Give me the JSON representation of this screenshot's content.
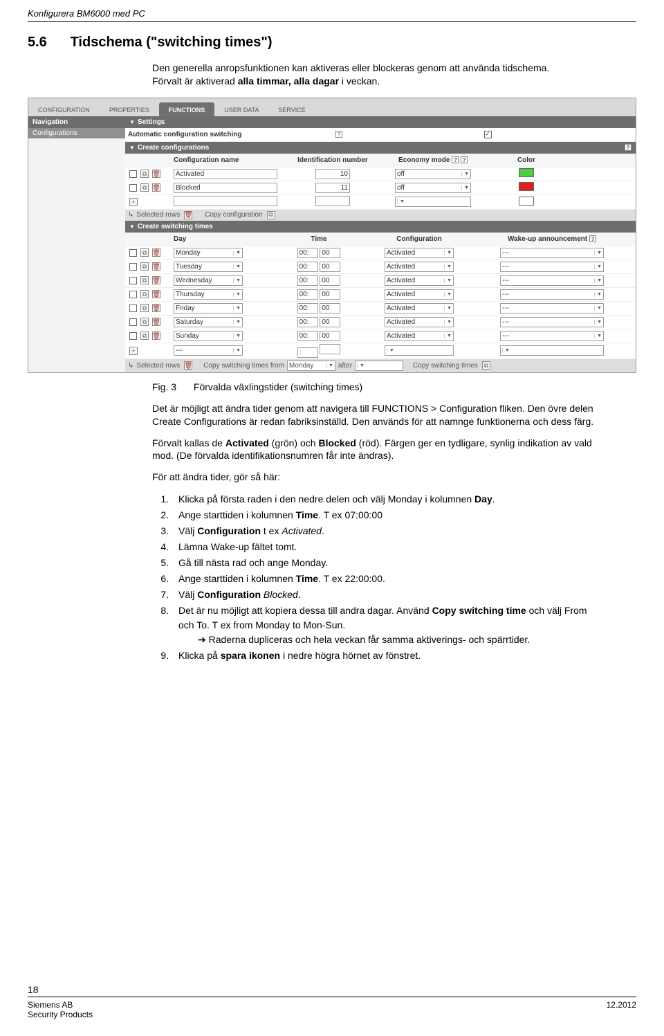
{
  "header": {
    "title": "Konfigurera BM6000 med PC"
  },
  "section": {
    "number": "5.6",
    "title": "Tidschema (\"switching times\")"
  },
  "intro": "Den generella anropsfunktionen kan aktiveras eller blockeras genom att använda tidschema. Förvalt är aktiverad alla timmar, alla dagar i veckan.",
  "ui": {
    "tabs": [
      "CONFIGURATION",
      "PROPERTIES",
      "FUNCTIONS",
      "USER DATA",
      "SERVICE"
    ],
    "active_tab": "FUNCTIONS",
    "sidebar": {
      "title": "Navigation",
      "items": [
        "Configurations"
      ]
    },
    "panels": {
      "settings": {
        "title": "Settings",
        "label": "Automatic configuration switching",
        "checked": true
      },
      "create_configs": {
        "title": "Create configurations",
        "headers": [
          "Configuration name",
          "Identification number",
          "Economy mode",
          "Color"
        ],
        "rows": [
          {
            "name": "Activated",
            "id": "10",
            "econ": "off",
            "color": "#4bcf3a"
          },
          {
            "name": "Blocked",
            "id": "11",
            "econ": "off",
            "color": "#e02020"
          },
          {
            "name": "",
            "id": "",
            "econ": "",
            "color": ""
          }
        ],
        "footer": {
          "selected": "Selected rows",
          "copy": "Copy configuration"
        }
      },
      "switching": {
        "title": "Create switching times",
        "headers": [
          "Day",
          "Time",
          "Configuration",
          "Wake-up announcement"
        ],
        "rows": [
          {
            "day": "Monday",
            "h": "00:",
            "m": "00",
            "conf": "Activated",
            "wake": "---"
          },
          {
            "day": "Tuesday",
            "h": "00:",
            "m": "00",
            "conf": "Activated",
            "wake": "---"
          },
          {
            "day": "Wednesday",
            "h": "00:",
            "m": "00",
            "conf": "Activated",
            "wake": "---"
          },
          {
            "day": "Thursday",
            "h": "00:",
            "m": "00",
            "conf": "Activated",
            "wake": "---"
          },
          {
            "day": "Friday",
            "h": "00:",
            "m": "00",
            "conf": "Activated",
            "wake": "---"
          },
          {
            "day": "Saturday",
            "h": "00:",
            "m": "00",
            "conf": "Activated",
            "wake": "---"
          },
          {
            "day": "Sunday",
            "h": "00:",
            "m": "00",
            "conf": "Activated",
            "wake": "---"
          },
          {
            "day": "---",
            "h": ":",
            "m": "",
            "conf": "",
            "wake": ""
          }
        ],
        "footer": {
          "selected": "Selected rows",
          "copy_label": "Copy switching times from",
          "from": "Monday",
          "after_label": "after",
          "after": "",
          "btn": "Copy switching times"
        }
      }
    }
  },
  "figure": {
    "number": "Fig. 3",
    "caption": "Förvalda växlingstider (switching times)"
  },
  "para1": "Det är möjligt att ändra tider genom att navigera till FUNCTIONS > Configuration fliken. Den övre delen Create Configurations är redan fabriksinställd. Den används för att namnge funktionerna och dess färg.",
  "para2_a": "Förvalt kallas de ",
  "para2_b": "Activated",
  "para2_c": " (grön) och ",
  "para2_d": "Blocked",
  "para2_e": " (röd). Färgen ger en tydligare, synlig indikation av vald mod. (De förvalda identifikationsnumren får inte ändras).",
  "para3": "För att ändra tider, gör så här:",
  "steps": [
    "Klicka på första raden i den nedre delen och välj Monday i kolumnen <b>Day</b>.",
    "Ange starttiden i kolumnen <b>Time</b>. T ex 07:00:00",
    "Välj <b>Configuration</b> t ex <i>Activated</i>.",
    "Lämna Wake-up fältet tomt.",
    "Gå till nästa rad och ange Monday.",
    "Ange starttiden i kolumnen <b>Time</b>. T ex 22:00:00.",
    "Välj <b>Configuration</b> <i>Blocked</i>.",
    "Det är nu möjligt att kopiera dessa till andra dagar. Använd <b>Copy switching time</b> och välj From och To. T ex from Monday to Mon-Sun.",
    "Klicka på <b>spara ikonen</b> i nedre högra hörnet av fönstret."
  ],
  "step8_sub": "Raderna dupliceras och hela veckan får samma aktiverings- och spärrtider.",
  "footer": {
    "page": "18",
    "left1": "Siemens AB",
    "left2": "Security Products",
    "right": "12.2012"
  }
}
